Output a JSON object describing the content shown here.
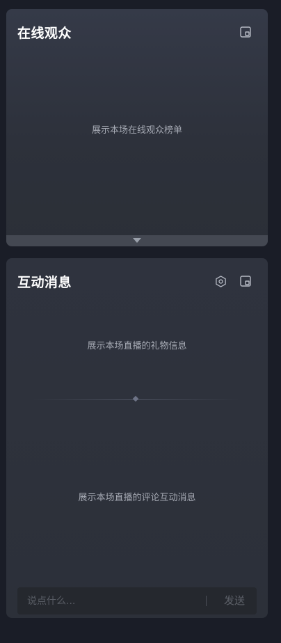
{
  "audience_panel": {
    "title": "在线观众",
    "popout_icon": "popout-window-icon",
    "empty_text": "展示本场在线观众榜单",
    "collapse_icon": "triangle-down-icon"
  },
  "messages_panel": {
    "title": "互动消息",
    "settings_icon": "hexagon-settings-icon",
    "popout_icon": "popout-window-icon",
    "gifts_empty_text": "展示本场直播的礼物信息",
    "comments_empty_text": "展示本场直播的评论互动消息",
    "chat": {
      "placeholder": "说点什么...",
      "value": "",
      "send_label": "发送"
    }
  },
  "colors": {
    "background": "#1a1d27",
    "panel": "#30343f",
    "title": "#ffffff",
    "muted_text": "#a5a9b3",
    "icon": "#b8bcc6"
  }
}
